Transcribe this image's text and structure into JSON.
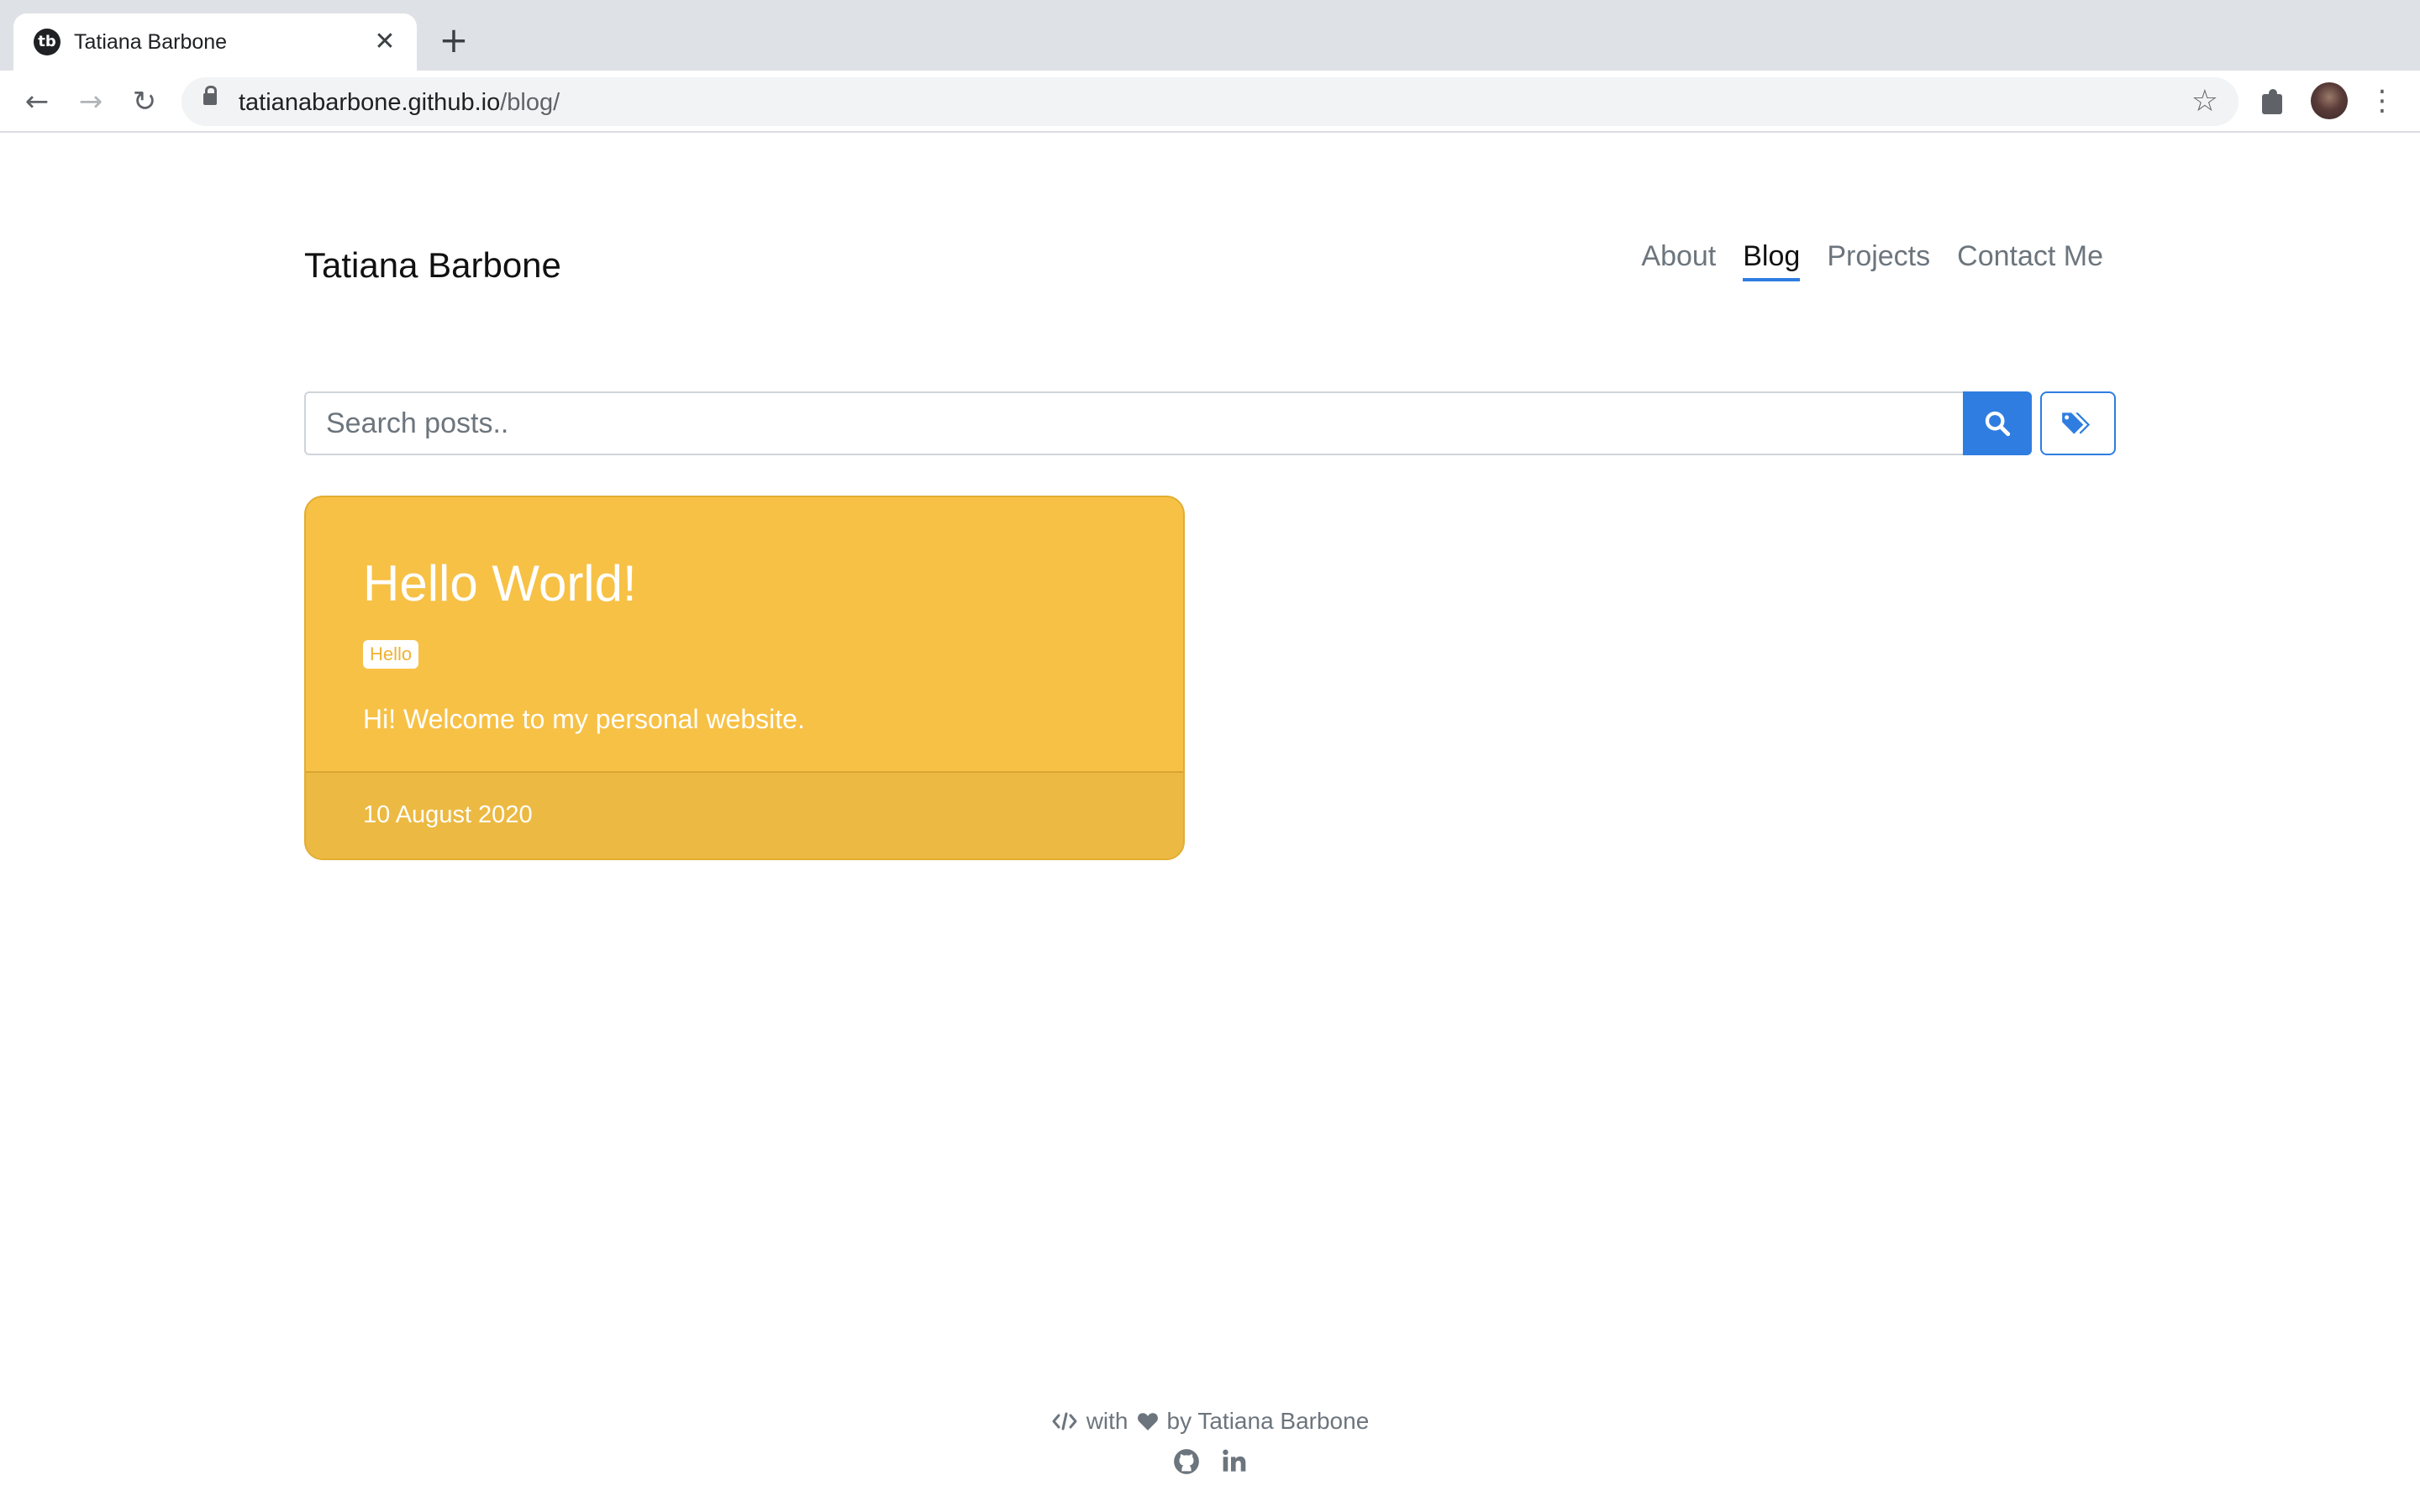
{
  "browser": {
    "tab_title": "Tatiana Barbone",
    "tab_favicon_text": "tb",
    "url_host": "tatianabarbone.github.io",
    "url_path": "/blog/"
  },
  "site": {
    "title": "Tatiana Barbone",
    "nav": [
      "About",
      "Blog",
      "Projects",
      "Contact Me"
    ],
    "active_nav": "Blog"
  },
  "search": {
    "placeholder": "Search posts.."
  },
  "posts": [
    {
      "title": "Hello World!",
      "tag": "Hello",
      "excerpt": "Hi! Welcome to my personal website.",
      "date": "10 August 2020"
    }
  ],
  "footer": {
    "with_text": "with",
    "by_text": "by Tatiana Barbone",
    "icons": [
      "github-icon",
      "linkedin-icon"
    ]
  },
  "colors": {
    "accent": "#2f7de1",
    "card": "#f7c146",
    "card_footer": "#ecb942"
  }
}
